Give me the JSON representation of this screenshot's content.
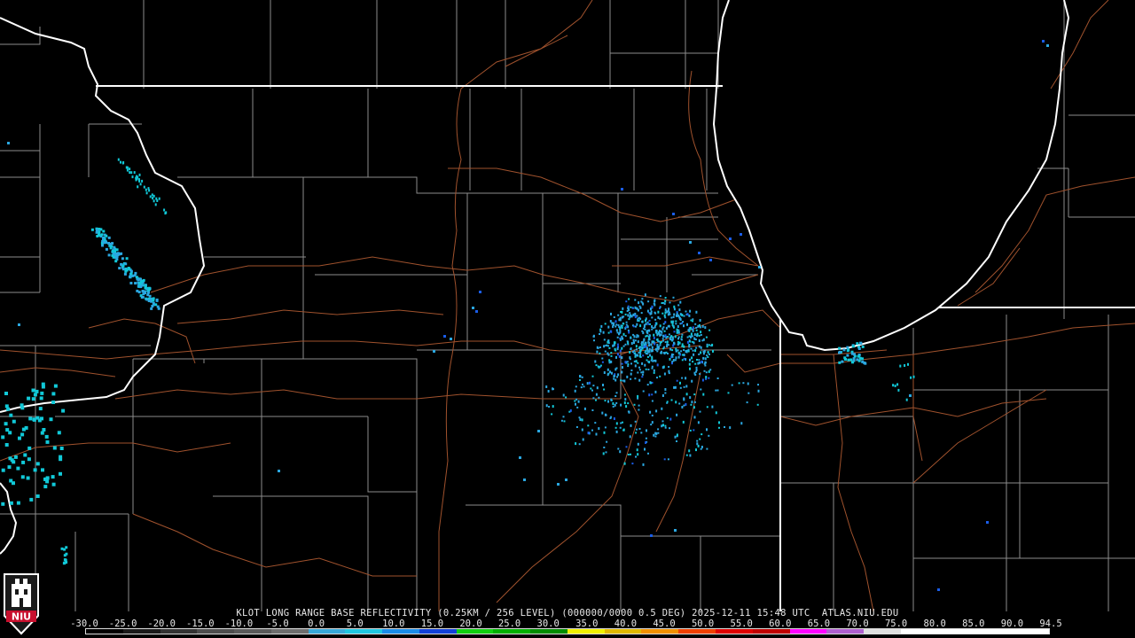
{
  "product": {
    "title": "KLOT LONG RANGE BASE REFLECTIVITY (0.25KM / 256 LEVEL) (000000/0000 0.5 DEG) 2025-12-11 15:48 UTC  ATLAS.NIU.EDU"
  },
  "logo": {
    "text": "NIU",
    "color": "#c8102e"
  },
  "colors": {
    "background": "#000000",
    "state_border": "#ffffff",
    "county_line": "#8c8c8c",
    "road": "#a0522d",
    "echo_light": "#2aa7e0",
    "echo_mid": "#11c9d8",
    "echo_dark": "#1a5de8"
  },
  "legend": {
    "ticks": [
      "-30.0",
      "-25.0",
      "-20.0",
      "-15.0",
      "-10.0",
      "-5.0",
      "0.0",
      "5.0",
      "10.0",
      "15.0",
      "20.0",
      "25.0",
      "30.0",
      "35.0",
      "40.0",
      "45.0",
      "50.0",
      "55.0",
      "60.0",
      "65.0",
      "70.0",
      "75.0",
      "80.0",
      "85.0",
      "90.0",
      "94.5"
    ],
    "colors": [
      "#000000",
      "#1a1a1a",
      "#333333",
      "#4d4d4d",
      "#5a5a5a",
      "#6e6e6e",
      "#37a8d8",
      "#1fc6e0",
      "#1a8ce8",
      "#1240d8",
      "#10d010",
      "#00b000",
      "#008c00",
      "#f0f000",
      "#e0b800",
      "#f09000",
      "#f04000",
      "#e00000",
      "#c00000",
      "#ff00ff",
      "#b060d0",
      "#e0e0e0",
      "#ffffff",
      "#ffffff",
      "#ffffff",
      "#ffffff"
    ]
  }
}
